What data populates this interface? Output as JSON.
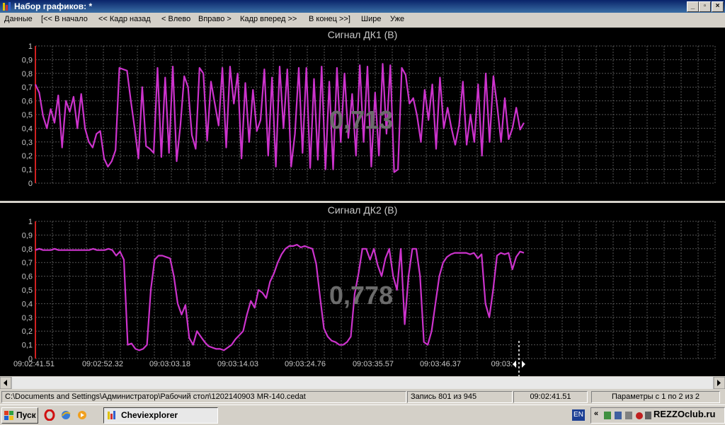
{
  "window": {
    "title": "Набор графиков: *"
  },
  "menu": [
    "Данные",
    "[<< В начало",
    "<< Кадр назад",
    "< Влево",
    "Вправо >",
    "Кадр вперед >>",
    "В конец >>]",
    "Шире",
    "Уже"
  ],
  "time_labels": [
    "09:02:41.51",
    "09:02:52.32",
    "09:03:03.18",
    "09:03:14.03",
    "09:03:24.76",
    "09:03:35.57",
    "09:03:46.37",
    "09:03:4"
  ],
  "chart_data": [
    {
      "type": "line",
      "title": "Сигнал ДК1  (В)",
      "readout": "0,713",
      "ylim": [
        0,
        1
      ],
      "y_ticks": [
        "0",
        "0,1",
        "0,2",
        "0,3",
        "0,4",
        "0,5",
        "0,6",
        "0,7",
        "0,8",
        "0,9",
        "1"
      ],
      "color": "#cc33cc",
      "series": [
        {
          "values": [
            0.72,
            0.66,
            0.49,
            0.4,
            0.54,
            0.44,
            0.64,
            0.26,
            0.6,
            0.52,
            0.63,
            0.4,
            0.65,
            0.4,
            0.3,
            0.26,
            0.36,
            0.38,
            0.18,
            0.12,
            0.16,
            0.24,
            0.84,
            0.83,
            0.82,
            0.6,
            0.4,
            0.18,
            0.7,
            0.27,
            0.25,
            0.22,
            0.84,
            0.19,
            0.77,
            0.22,
            0.85,
            0.16,
            0.42,
            0.78,
            0.7,
            0.35,
            0.25,
            0.84,
            0.8,
            0.31,
            0.74,
            0.58,
            0.42,
            0.84,
            0.26,
            0.85,
            0.58,
            0.8,
            0.18,
            0.73,
            0.3,
            0.68,
            0.38,
            0.46,
            0.83,
            0.2,
            0.77,
            0.12,
            0.85,
            0.4,
            0.83,
            0.12,
            0.36,
            0.84,
            0.22,
            0.84,
            0.11,
            0.76,
            0.17,
            0.85,
            0.1,
            0.74,
            0.1,
            0.84,
            0.3,
            0.8,
            0.33,
            0.65,
            0.2,
            0.86,
            0.3,
            0.85,
            0.12,
            0.66,
            0.2,
            0.87,
            0.36,
            0.86,
            0.08,
            0.1,
            0.84,
            0.79,
            0.58,
            0.62,
            0.49,
            0.3,
            0.68,
            0.46,
            0.72,
            0.25,
            0.77,
            0.4,
            0.55,
            0.4,
            0.28,
            0.42,
            0.74,
            0.28,
            0.5,
            0.3,
            0.72,
            0.2,
            0.8,
            0.3,
            0.78,
            0.56,
            0.3,
            0.62,
            0.32,
            0.4,
            0.55,
            0.39,
            0.44
          ]
        }
      ]
    },
    {
      "type": "line",
      "title": "Сигнал ДК2  (В)",
      "readout": "0,778",
      "ylim": [
        0,
        1
      ],
      "y_ticks": [
        "0",
        "0,1",
        "0,2",
        "0,3",
        "0,4",
        "0,5",
        "0,6",
        "0,7",
        "0,8",
        "0,9",
        "1"
      ],
      "color": "#cc33cc",
      "series": [
        {
          "values": [
            0.79,
            0.8,
            0.79,
            0.79,
            0.79,
            0.8,
            0.79,
            0.79,
            0.79,
            0.79,
            0.79,
            0.79,
            0.79,
            0.79,
            0.79,
            0.8,
            0.79,
            0.79,
            0.79,
            0.8,
            0.79,
            0.75,
            0.78,
            0.72,
            0.1,
            0.11,
            0.07,
            0.06,
            0.07,
            0.1,
            0.5,
            0.72,
            0.75,
            0.75,
            0.74,
            0.73,
            0.6,
            0.4,
            0.32,
            0.39,
            0.15,
            0.1,
            0.2,
            0.16,
            0.12,
            0.09,
            0.08,
            0.07,
            0.07,
            0.06,
            0.08,
            0.1,
            0.14,
            0.17,
            0.2,
            0.32,
            0.42,
            0.37,
            0.5,
            0.48,
            0.44,
            0.56,
            0.62,
            0.7,
            0.76,
            0.8,
            0.82,
            0.82,
            0.83,
            0.81,
            0.82,
            0.81,
            0.8,
            0.69,
            0.45,
            0.22,
            0.16,
            0.13,
            0.12,
            0.1,
            0.1,
            0.12,
            0.16,
            0.47,
            0.62,
            0.8,
            0.8,
            0.72,
            0.8,
            0.68,
            0.6,
            0.73,
            0.8,
            0.6,
            0.5,
            0.8,
            0.25,
            0.6,
            0.8,
            0.8,
            0.6,
            0.12,
            0.1,
            0.2,
            0.4,
            0.6,
            0.7,
            0.74,
            0.76,
            0.77,
            0.77,
            0.77,
            0.77,
            0.76,
            0.77,
            0.73,
            0.76,
            0.4,
            0.3,
            0.5,
            0.75,
            0.77,
            0.76,
            0.77,
            0.65,
            0.74,
            0.78,
            0.77
          ]
        }
      ]
    }
  ],
  "statusbar": {
    "path": "C:\\Documents and Settings\\Администратор\\Рабочий стол\\1202140903 MR-140.cedat",
    "record": "Запись 801 из 945",
    "time": "09:02:41.51",
    "params": "Параметры с 1 по 2 из 2"
  },
  "taskbar": {
    "start": "Пуск",
    "task": "Cheviexplorer",
    "lang": "EN",
    "tray_text": "REZZOclub.ru"
  }
}
